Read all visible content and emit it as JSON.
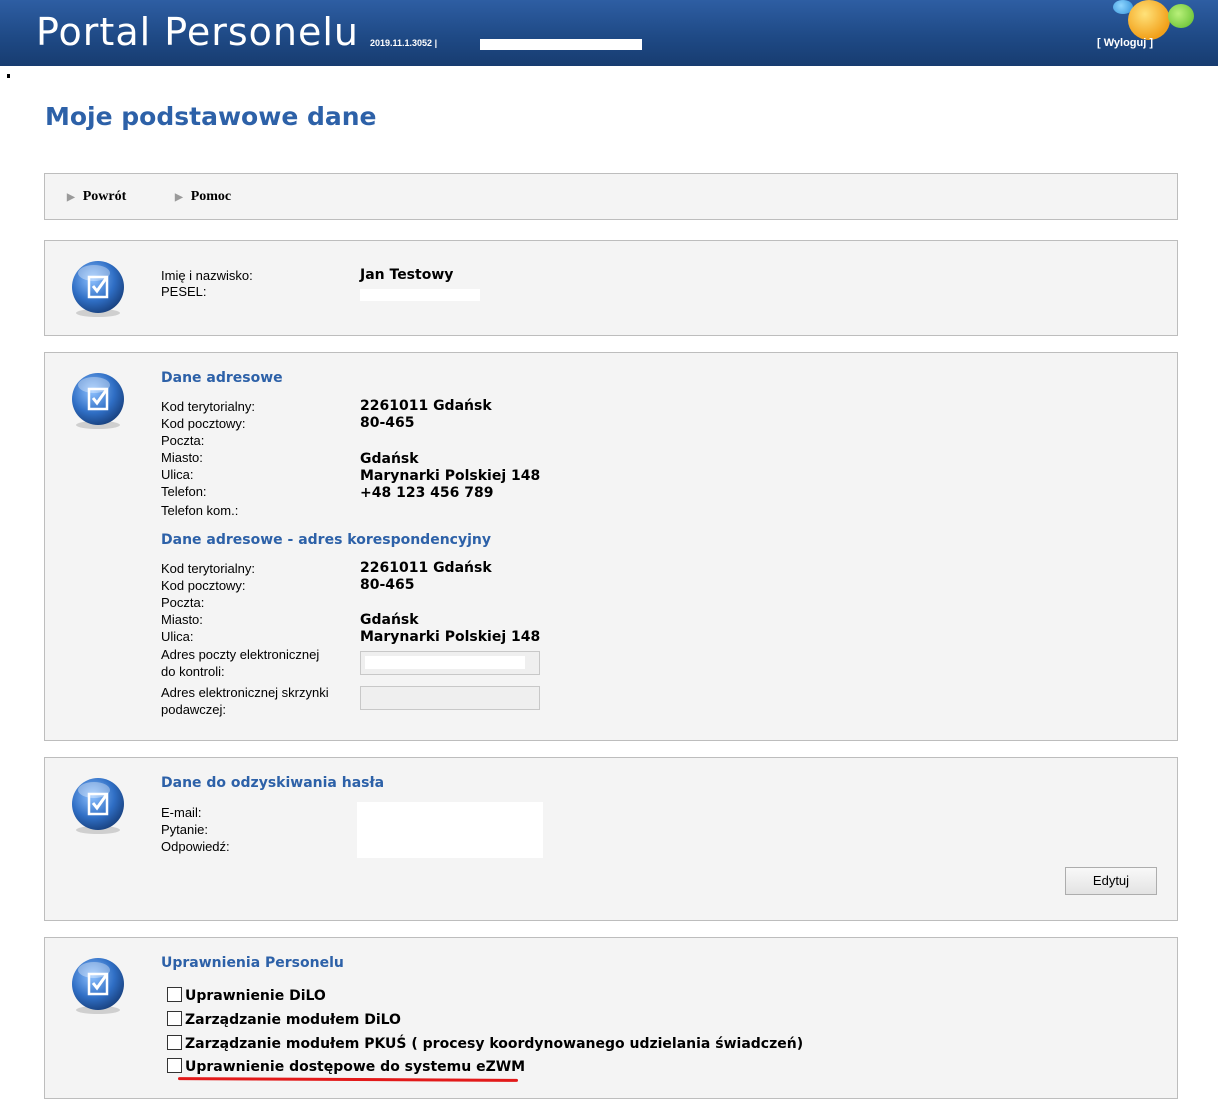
{
  "header": {
    "app_title": "Portal Personelu",
    "version": "2019.11.1.3052 |",
    "logout": "[ Wyloguj ]"
  },
  "page_title": "Moje podstawowe dane",
  "nav": {
    "back": "Powrót",
    "help": "Pomoc"
  },
  "person": {
    "name_label": "Imię i nazwisko:",
    "name_value": "Jan Testowy",
    "pesel_label": "PESEL:"
  },
  "address": {
    "title": "Dane adresowe",
    "fields": [
      {
        "label": "Kod terytorialny:",
        "value": "2261011   Gdańsk"
      },
      {
        "label": "Kod pocztowy:",
        "value": "80-465"
      },
      {
        "label": "Poczta:",
        "value": ""
      },
      {
        "label": "Miasto:",
        "value": "Gdańsk"
      },
      {
        "label": "Ulica:",
        "value": "Marynarki Polskiej 148"
      },
      {
        "label": "Telefon:",
        "value": "+48 123 456 789"
      },
      {
        "label": "Telefon kom.:",
        "value": ""
      }
    ]
  },
  "corr_address": {
    "title": "Dane adresowe - adres korespondencyjny",
    "fields": [
      {
        "label": "Kod terytorialny:",
        "value": "2261011   Gdańsk"
      },
      {
        "label": "Kod pocztowy:",
        "value": "80-465"
      },
      {
        "label": "Poczta:",
        "value": ""
      },
      {
        "label": "Miasto:",
        "value": "Gdańsk"
      },
      {
        "label": "Ulica:",
        "value": "Marynarki Polskiej 148"
      }
    ],
    "email_label_1": "Adres poczty elektronicznej",
    "email_label_2": "do kontroli:",
    "epuap_label_1": "Adres elektronicznej skrzynki",
    "epuap_label_2": "podawczej:"
  },
  "recovery": {
    "title": "Dane do odzyskiwania hasła",
    "email_label": "E-mail:",
    "question_label": "Pytanie:",
    "answer_label": "Odpowiedź:",
    "edit_button": "Edytuj"
  },
  "permissions": {
    "title": "Uprawnienia Personelu",
    "items": [
      {
        "label": "Uprawnienie DiLO",
        "checked": false
      },
      {
        "label": "Zarządzanie modułem DiLO",
        "checked": false
      },
      {
        "label": "Zarządzanie modułem PKUŚ ( procesy koordynowanego udzielania świadczeń)",
        "checked": false
      },
      {
        "label": "Uprawnienie dostępowe do systemu eZWM",
        "checked": false
      }
    ]
  },
  "colors": {
    "header": "#1f4a86",
    "accent": "#2d61a8",
    "panel": "#f4f4f4",
    "annotation": "#e21a1a"
  }
}
